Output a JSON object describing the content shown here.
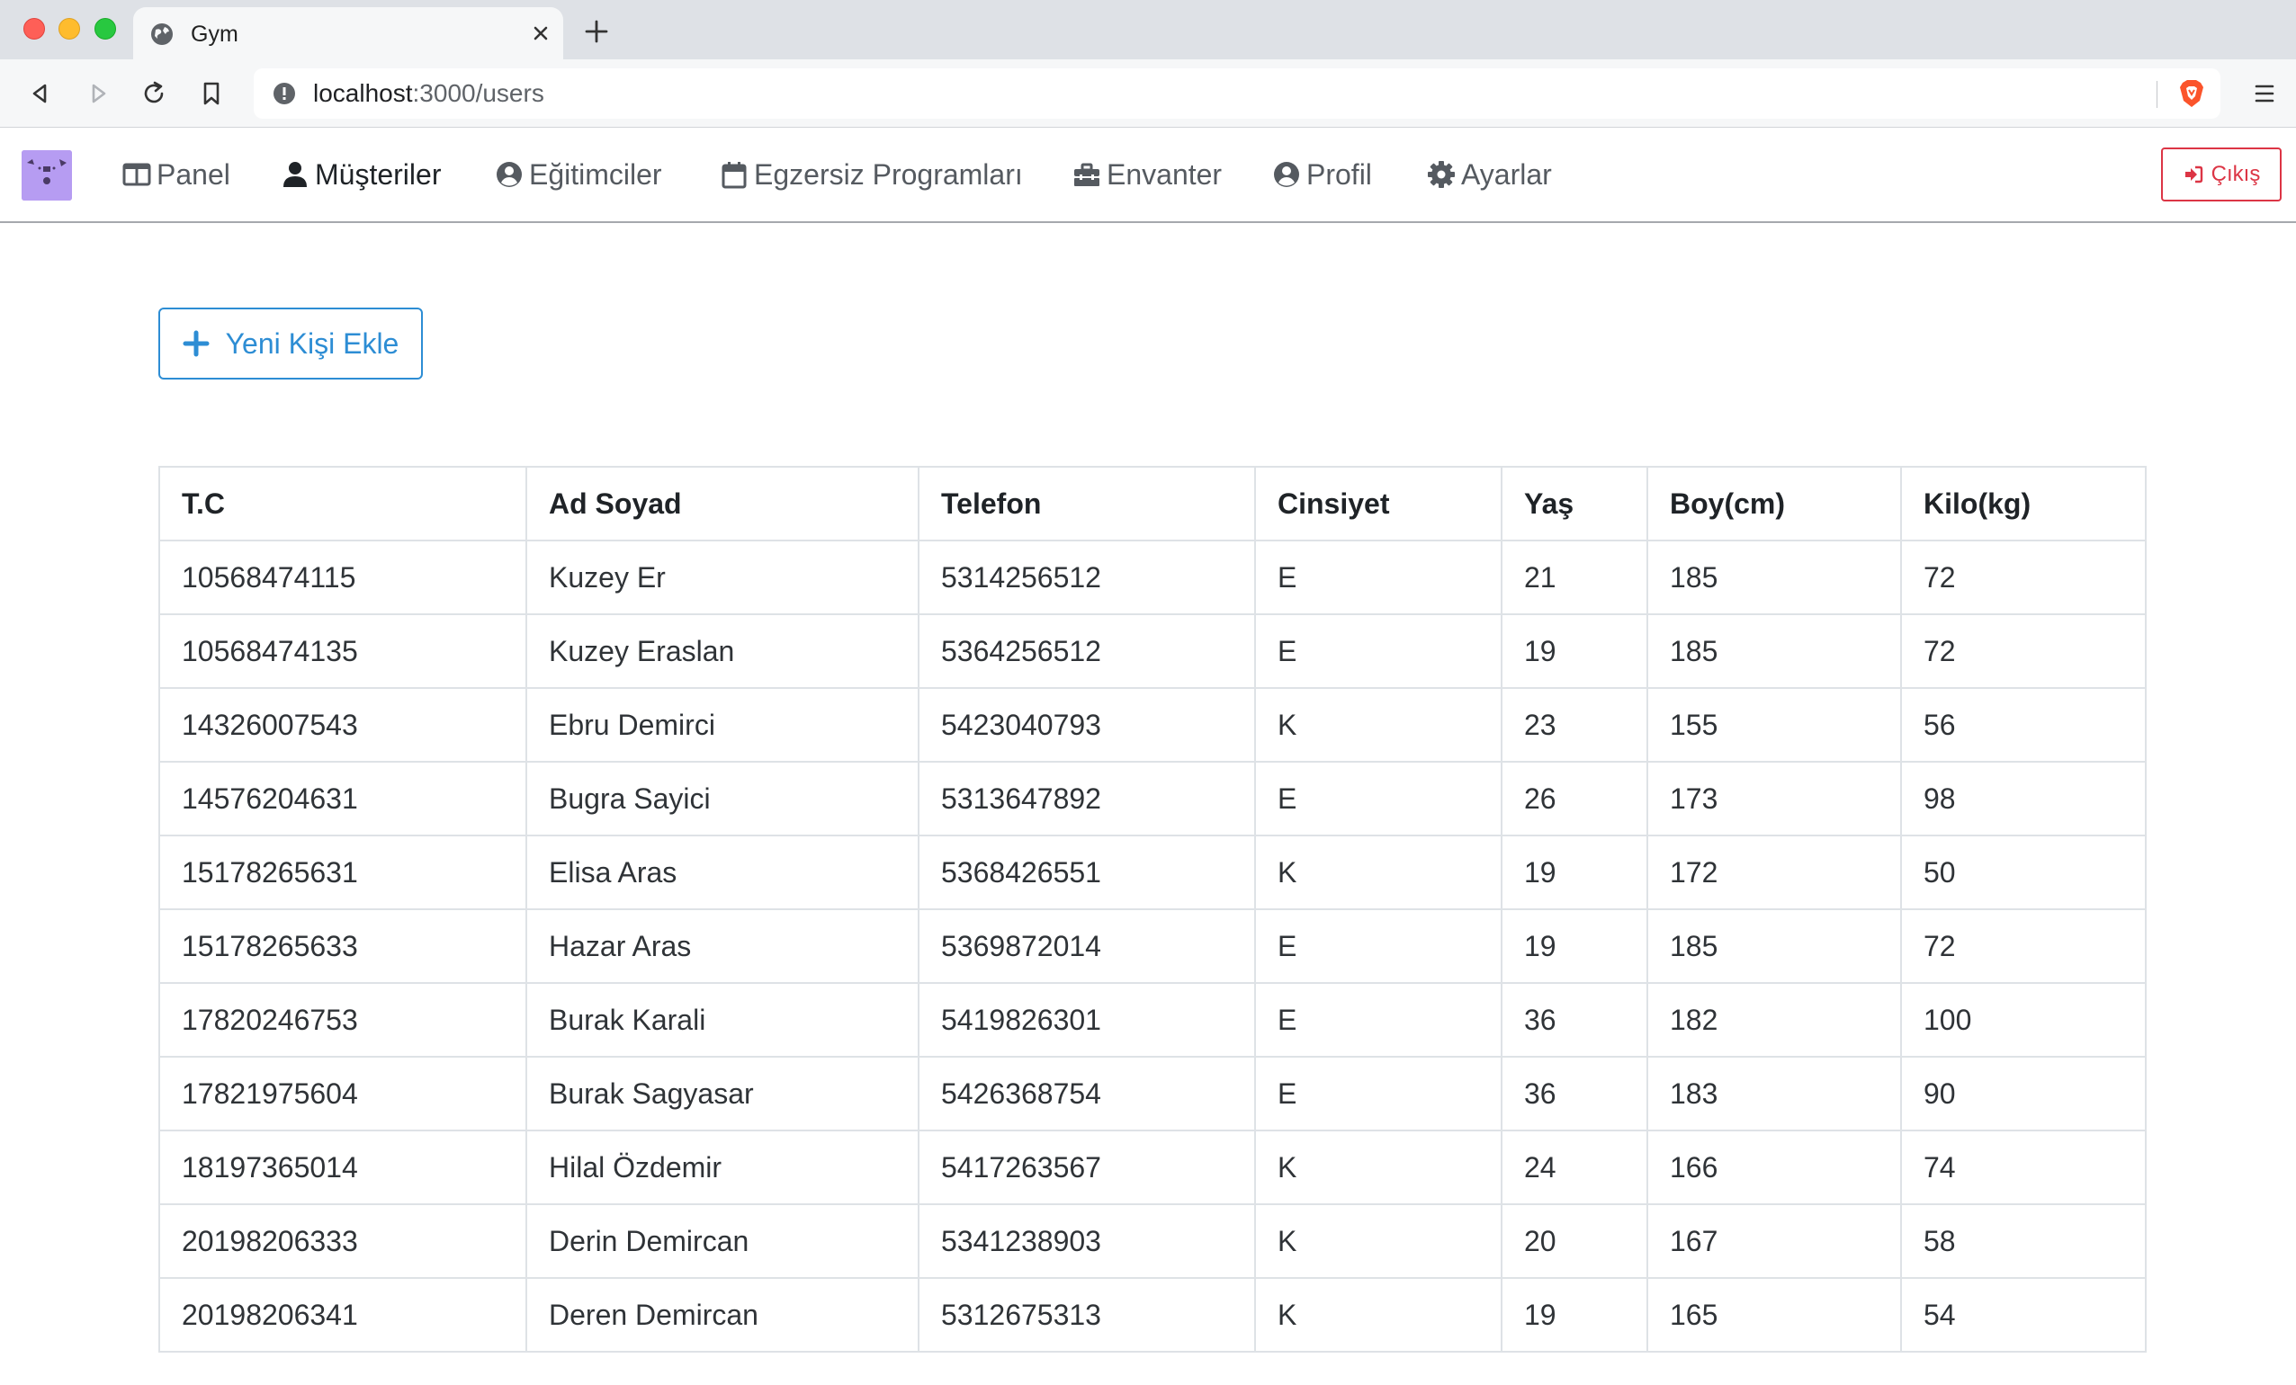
{
  "browser": {
    "tab_title": "Gym",
    "url_host": "localhost",
    "url_path": ":3000/users"
  },
  "nav": {
    "brand_icon": "gym-logo",
    "items": [
      {
        "label": "Panel",
        "icon": "columns-icon"
      },
      {
        "label": "Müşteriler",
        "icon": "user-icon",
        "active": true
      },
      {
        "label": "Eğitimciler",
        "icon": "user-circle-icon"
      },
      {
        "label": "Egzersiz Programları",
        "icon": "calendar-icon"
      },
      {
        "label": "Envanter",
        "icon": "toolbox-icon"
      },
      {
        "label": "Profil",
        "icon": "user-circle-icon"
      },
      {
        "label": "Ayarlar",
        "icon": "gear-icon"
      }
    ],
    "logout_label": "Çıkış"
  },
  "main": {
    "add_button_label": "Yeni Kişi Ekle",
    "table": {
      "headers": [
        "T.C",
        "Ad Soyad",
        "Telefon",
        "Cinsiyet",
        "Yaş",
        "Boy(cm)",
        "Kilo(kg)"
      ],
      "rows": [
        [
          "10568474115",
          "Kuzey Er",
          "5314256512",
          "E",
          "21",
          "185",
          "72"
        ],
        [
          "10568474135",
          "Kuzey Eraslan",
          "5364256512",
          "E",
          "19",
          "185",
          "72"
        ],
        [
          "14326007543",
          "Ebru Demirci",
          "5423040793",
          "K",
          "23",
          "155",
          "56"
        ],
        [
          "14576204631",
          "Bugra Sayici",
          "5313647892",
          "E",
          "26",
          "173",
          "98"
        ],
        [
          "15178265631",
          "Elisa Aras",
          "5368426551",
          "K",
          "19",
          "172",
          "50"
        ],
        [
          "15178265633",
          "Hazar Aras",
          "5369872014",
          "E",
          "19",
          "185",
          "72"
        ],
        [
          "17820246753",
          "Burak Karali",
          "5419826301",
          "E",
          "36",
          "182",
          "100"
        ],
        [
          "17821975604",
          "Burak Sagyasar",
          "5426368754",
          "E",
          "36",
          "183",
          "90"
        ],
        [
          "18197365014",
          "Hilal Özdemir",
          "5417263567",
          "K",
          "24",
          "166",
          "74"
        ],
        [
          "20198206333",
          "Derin Demircan",
          "5341238903",
          "K",
          "20",
          "167",
          "58"
        ],
        [
          "20198206341",
          "Deren Demircan",
          "5312675313",
          "K",
          "19",
          "165",
          "54"
        ]
      ]
    }
  },
  "colors": {
    "primary": "#2d8dd4",
    "danger": "#dc3545",
    "brand_bg": "#b69cf2"
  }
}
